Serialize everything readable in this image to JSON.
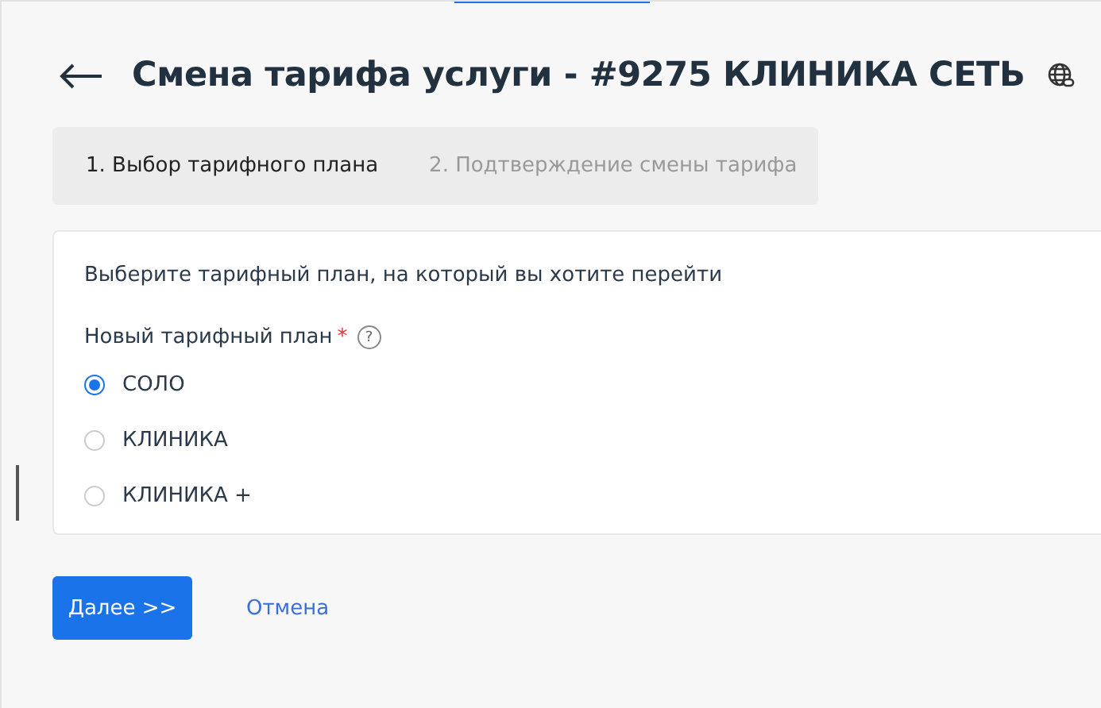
{
  "title": "Смена тарифа услуги - #9275 КЛИНИКА СЕТЬ",
  "steps": [
    {
      "label": "1. Выбор тарифного плана",
      "selected": true
    },
    {
      "label": "2. Подтверждение смены тарифа",
      "selected": false
    }
  ],
  "form": {
    "intro": "Выберите тарифный план, на который вы хотите перейти",
    "field_label": "Новый тарифный план",
    "required_mark": "*",
    "help": "?",
    "options": [
      {
        "label": "СОЛО",
        "selected": true
      },
      {
        "label": "КЛИНИКА",
        "selected": false
      },
      {
        "label": "КЛИНИКА +",
        "selected": false
      }
    ]
  },
  "buttons": {
    "next": "Далее >>",
    "cancel": "Отмена"
  }
}
